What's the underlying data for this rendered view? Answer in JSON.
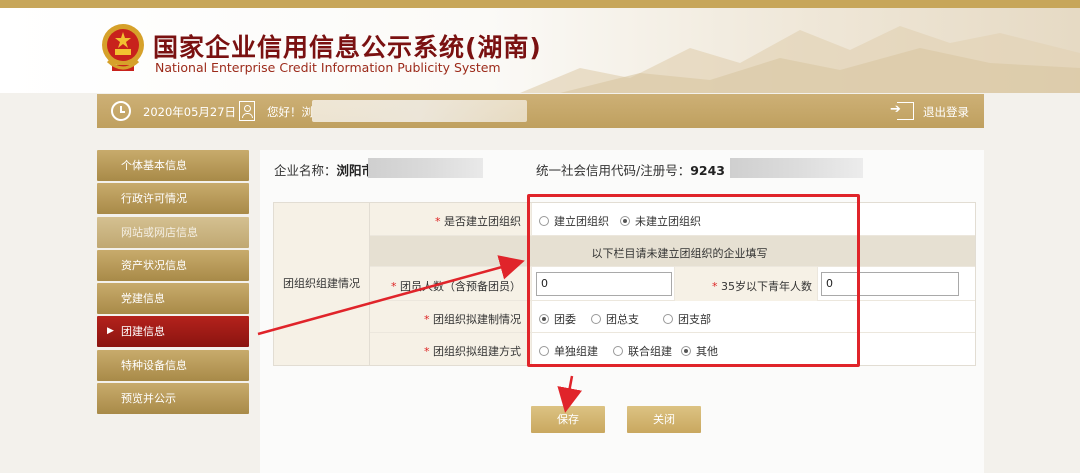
{
  "header": {
    "title": "国家企业信用信息公示系统(湖南)",
    "subtitle": "National Enterprise Credit Information Publicity System",
    "emblem_icon": "national-emblem-icon"
  },
  "infobar": {
    "date": "2020年05月27日",
    "greeting": "您好！浏",
    "logout": "退出登录"
  },
  "sidebar": {
    "items": [
      {
        "label": "个体基本信息",
        "state": "normal"
      },
      {
        "label": "行政许可情况",
        "state": "normal"
      },
      {
        "label": "网站或网店信息",
        "state": "muted"
      },
      {
        "label": "资产状况信息",
        "state": "normal"
      },
      {
        "label": "党建信息",
        "state": "normal"
      },
      {
        "label": "团建信息",
        "state": "active"
      },
      {
        "label": "特种设备信息",
        "state": "normal"
      },
      {
        "label": "预览并公示",
        "state": "normal"
      }
    ]
  },
  "main": {
    "corp_label": "企业名称：",
    "corp_value": "浏阳市",
    "credit_label": "统一社会信用代码/注册号：",
    "credit_value": "9243"
  },
  "form": {
    "section_label": "团组织组建情况",
    "q1": {
      "label": "是否建立团组织",
      "options": [
        "建立团组织",
        "未建立团组织"
      ],
      "selected": 1
    },
    "banner": "以下栏目请未建立团组织的企业填写",
    "members": {
      "label": "团员人数（含预备团员）",
      "value": "0"
    },
    "youth": {
      "label": "35岁以下青年人数",
      "value": "0"
    },
    "q_system": {
      "label": "团组织拟建制情况",
      "options": [
        "团委",
        "团总支",
        "团支部"
      ],
      "selected": 0
    },
    "q_method": {
      "label": "团组织拟组建方式",
      "options": [
        "单独组建",
        "联合组建",
        "其他"
      ],
      "selected": 2
    },
    "required_mark": "*"
  },
  "buttons": {
    "save": "保存",
    "close": "关闭"
  },
  "colors": {
    "gold": "#c2a463",
    "active_red": "#a61b16",
    "highlight_red": "#e0242a",
    "title_red": "#7a1111"
  }
}
